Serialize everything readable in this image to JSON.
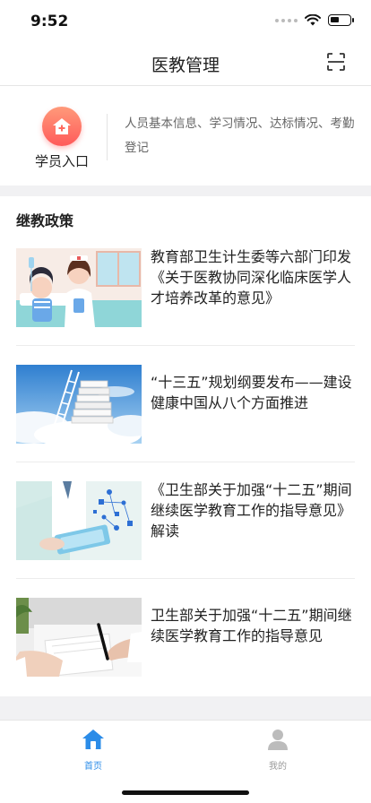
{
  "status_bar": {
    "time": "9:52",
    "battery_level": 0.45
  },
  "nav": {
    "title": "医教管理",
    "scan_icon": "scan-icon"
  },
  "entry": {
    "label": "学员入口",
    "icon": "home-plus-icon",
    "description": "人员基本信息、学习情况、达标情况、考勤登记"
  },
  "policy": {
    "section_title": "继教政策",
    "items": [
      {
        "title": "教育部卫生计生委等六部门印发《关于医教协同深化临床医学人才培养改革的意见》",
        "thumb": "nurse-patient-illustration"
      },
      {
        "title": "“十三五”规划纲要发布——建设健康中国从八个方面推进",
        "thumb": "books-ladder-clouds"
      },
      {
        "title": "《卫生部关于加强“十二五”期间继续医学教育工作的指导意见》解读",
        "thumb": "doctor-tablet-icons"
      },
      {
        "title": "卫生部关于加强“十二五”期间继续医学教育工作的指导意见",
        "thumb": "signing-document"
      }
    ]
  },
  "tabbar": {
    "home_label": "首页",
    "mine_label": "我的",
    "active_color": "#2b8ce8",
    "inactive_color": "#bcbcbc"
  }
}
